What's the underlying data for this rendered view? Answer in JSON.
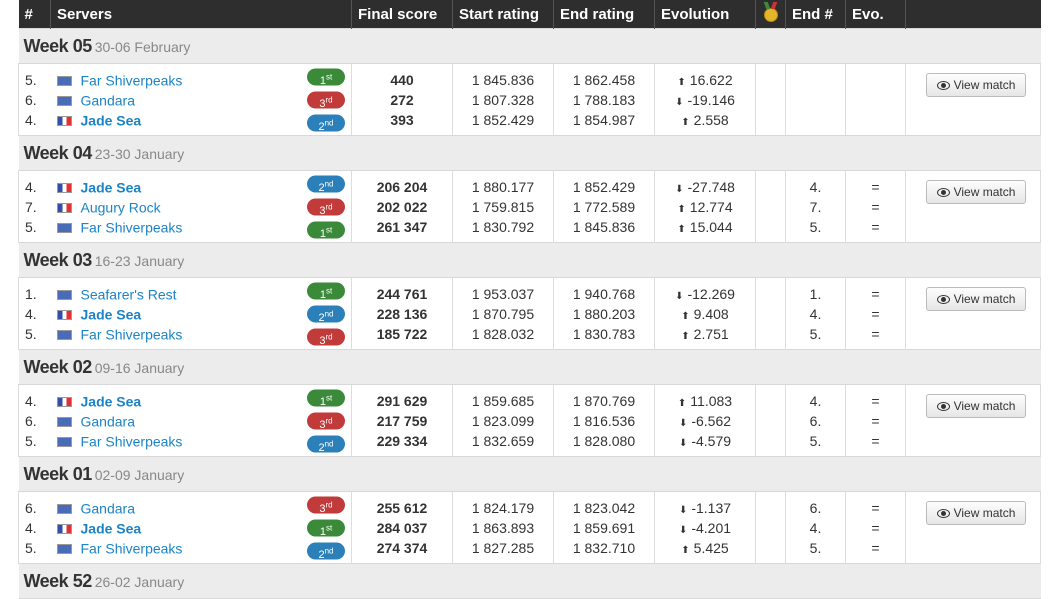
{
  "headers": {
    "rank": "#",
    "servers": "Servers",
    "final_score": "Final score",
    "start_rating": "Start rating",
    "end_rating": "End rating",
    "evolution": "Evolution",
    "medal_icon": "medal-icon",
    "end_rank": "End #",
    "evo": "Evo."
  },
  "view_match_label": "View match",
  "colors": {
    "header_bg": "#2e2e2e",
    "link": "#1c84c6",
    "up": "#1a9a1a",
    "down": "#c42222",
    "first": "#3a8a3a",
    "second": "#2b80b9",
    "third": "#c23b3b"
  },
  "weeks": [
    {
      "name": "Week 05",
      "dates": "30-06 February",
      "rows": [
        {
          "rank": "5.",
          "server": "Far Shiverpeaks",
          "flag": "eu",
          "own": false,
          "place": "1",
          "suffix": "st",
          "score": "440",
          "start": "1 845.836",
          "end": "1 862.458",
          "evolution": "16.622",
          "dir": "up",
          "end_rank": "",
          "evo": ""
        },
        {
          "rank": "6.",
          "server": "Gandara",
          "flag": "eu",
          "own": false,
          "place": "3",
          "suffix": "rd",
          "score": "272",
          "start": "1 807.328",
          "end": "1 788.183",
          "evolution": "-19.146",
          "dir": "down",
          "end_rank": "",
          "evo": ""
        },
        {
          "rank": "4.",
          "server": "Jade Sea",
          "flag": "fr",
          "own": true,
          "place": "2",
          "suffix": "nd",
          "score": "393",
          "start": "1 852.429",
          "end": "1 854.987",
          "evolution": "2.558",
          "dir": "up",
          "end_rank": "",
          "evo": ""
        }
      ]
    },
    {
      "name": "Week 04",
      "dates": "23-30 January",
      "rows": [
        {
          "rank": "4.",
          "server": "Jade Sea",
          "flag": "fr",
          "own": true,
          "place": "2",
          "suffix": "nd",
          "score": "206 204",
          "start": "1 880.177",
          "end": "1 852.429",
          "evolution": "-27.748",
          "dir": "down",
          "end_rank": "4.",
          "evo": "="
        },
        {
          "rank": "7.",
          "server": "Augury Rock",
          "flag": "fr",
          "own": false,
          "place": "3",
          "suffix": "rd",
          "score": "202 022",
          "start": "1 759.815",
          "end": "1 772.589",
          "evolution": "12.774",
          "dir": "up",
          "end_rank": "7.",
          "evo": "="
        },
        {
          "rank": "5.",
          "server": "Far Shiverpeaks",
          "flag": "eu",
          "own": false,
          "place": "1",
          "suffix": "st",
          "score": "261 347",
          "start": "1 830.792",
          "end": "1 845.836",
          "evolution": "15.044",
          "dir": "up",
          "end_rank": "5.",
          "evo": "="
        }
      ]
    },
    {
      "name": "Week 03",
      "dates": "16-23 January",
      "rows": [
        {
          "rank": "1.",
          "server": "Seafarer's Rest",
          "flag": "eu",
          "own": false,
          "place": "1",
          "suffix": "st",
          "score": "244 761",
          "start": "1 953.037",
          "end": "1 940.768",
          "evolution": "-12.269",
          "dir": "down",
          "end_rank": "1.",
          "evo": "="
        },
        {
          "rank": "4.",
          "server": "Jade Sea",
          "flag": "fr",
          "own": true,
          "place": "2",
          "suffix": "nd",
          "score": "228 136",
          "start": "1 870.795",
          "end": "1 880.203",
          "evolution": "9.408",
          "dir": "up",
          "end_rank": "4.",
          "evo": "="
        },
        {
          "rank": "5.",
          "server": "Far Shiverpeaks",
          "flag": "eu",
          "own": false,
          "place": "3",
          "suffix": "rd",
          "score": "185 722",
          "start": "1 828.032",
          "end": "1 830.783",
          "evolution": "2.751",
          "dir": "up",
          "end_rank": "5.",
          "evo": "="
        }
      ]
    },
    {
      "name": "Week 02",
      "dates": "09-16 January",
      "rows": [
        {
          "rank": "4.",
          "server": "Jade Sea",
          "flag": "fr",
          "own": true,
          "place": "1",
          "suffix": "st",
          "score": "291 629",
          "start": "1 859.685",
          "end": "1 870.769",
          "evolution": "11.083",
          "dir": "up",
          "end_rank": "4.",
          "evo": "="
        },
        {
          "rank": "6.",
          "server": "Gandara",
          "flag": "eu",
          "own": false,
          "place": "3",
          "suffix": "rd",
          "score": "217 759",
          "start": "1 823.099",
          "end": "1 816.536",
          "evolution": "-6.562",
          "dir": "down",
          "end_rank": "6.",
          "evo": "="
        },
        {
          "rank": "5.",
          "server": "Far Shiverpeaks",
          "flag": "eu",
          "own": false,
          "place": "2",
          "suffix": "nd",
          "score": "229 334",
          "start": "1 832.659",
          "end": "1 828.080",
          "evolution": "-4.579",
          "dir": "down",
          "end_rank": "5.",
          "evo": "="
        }
      ]
    },
    {
      "name": "Week 01",
      "dates": "02-09 January",
      "rows": [
        {
          "rank": "6.",
          "server": "Gandara",
          "flag": "eu",
          "own": false,
          "place": "3",
          "suffix": "rd",
          "score": "255 612",
          "start": "1 824.179",
          "end": "1 823.042",
          "evolution": "-1.137",
          "dir": "down",
          "end_rank": "6.",
          "evo": "="
        },
        {
          "rank": "4.",
          "server": "Jade Sea",
          "flag": "fr",
          "own": true,
          "place": "1",
          "suffix": "st",
          "score": "284 037",
          "start": "1 863.893",
          "end": "1 859.691",
          "evolution": "-4.201",
          "dir": "down",
          "end_rank": "4.",
          "evo": "="
        },
        {
          "rank": "5.",
          "server": "Far Shiverpeaks",
          "flag": "eu",
          "own": false,
          "place": "2",
          "suffix": "nd",
          "score": "274 374",
          "start": "1 827.285",
          "end": "1 832.710",
          "evolution": "5.425",
          "dir": "up",
          "end_rank": "5.",
          "evo": "="
        }
      ]
    },
    {
      "name": "Week 52",
      "dates": "26-02 January",
      "rows": []
    }
  ]
}
